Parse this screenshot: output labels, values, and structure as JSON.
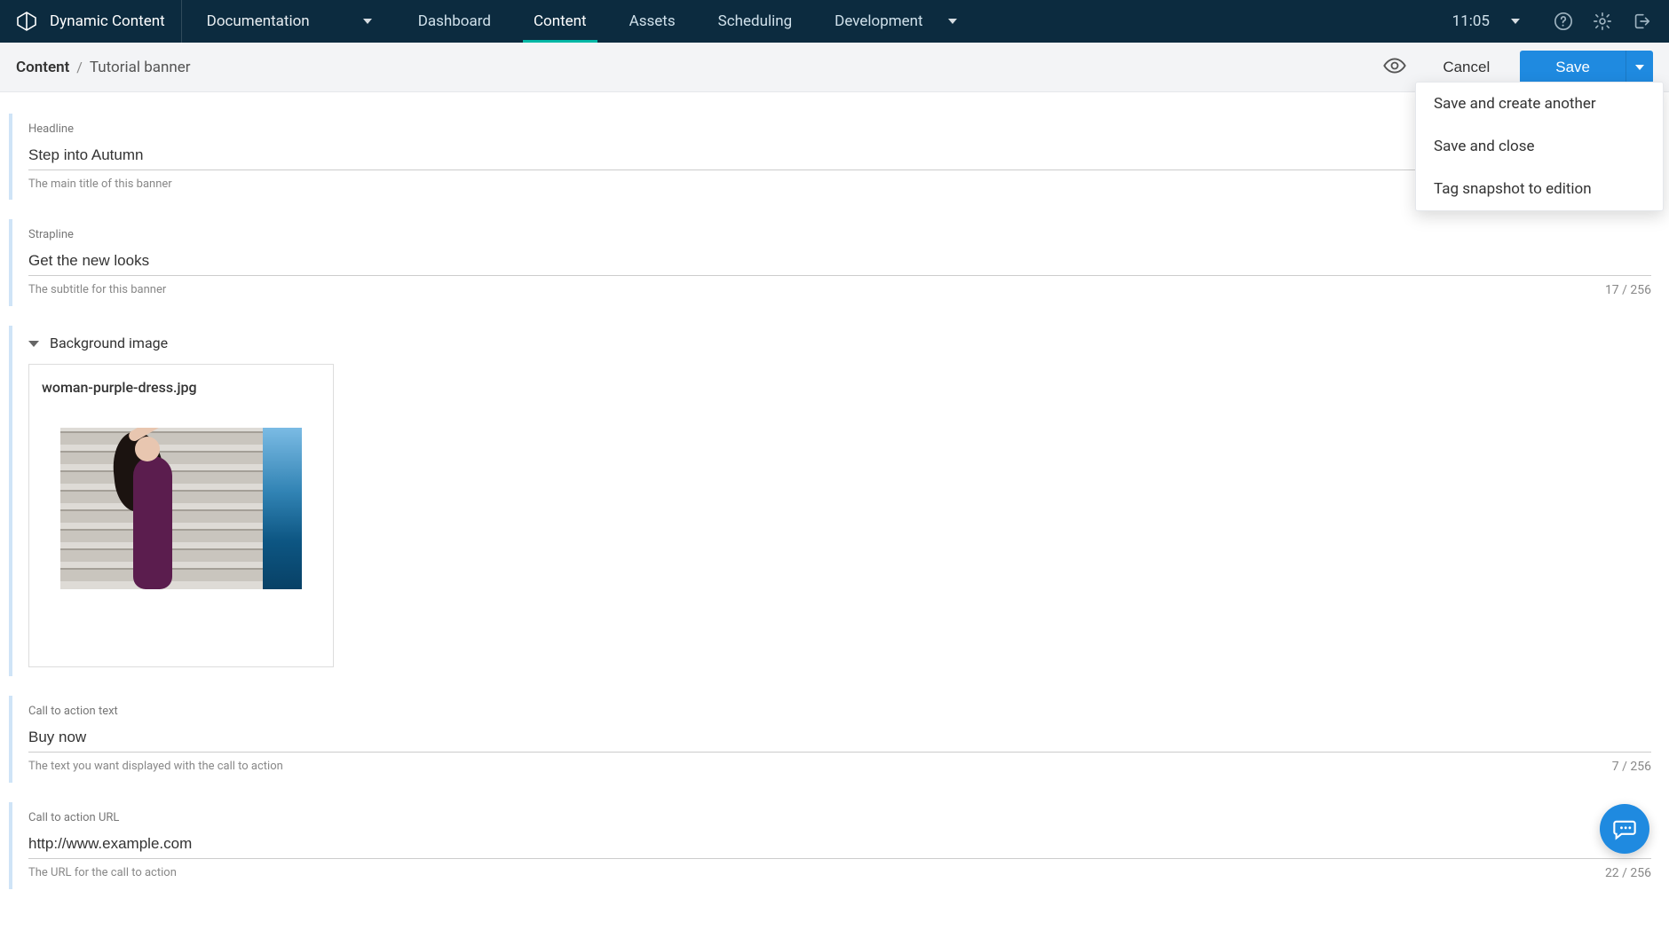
{
  "topbar": {
    "brand": "Dynamic Content",
    "documentation": "Documentation",
    "nav": [
      "Dashboard",
      "Content",
      "Assets",
      "Scheduling"
    ],
    "active_nav_index": 1,
    "development": "Development",
    "clock": "11:05"
  },
  "subbar": {
    "breadcrumb_root": "Content",
    "breadcrumb_leaf": "Tutorial banner",
    "cancel": "Cancel",
    "save": "Save"
  },
  "save_menu": [
    "Save and create another",
    "Save and close",
    "Tag snapshot to edition"
  ],
  "fields": {
    "headline": {
      "label": "Headline",
      "value": "Step into Autumn",
      "help": "The main title of this banner"
    },
    "strapline": {
      "label": "Strapline",
      "value": "Get the new looks",
      "help": "The subtitle for this banner",
      "counter": "17 / 256"
    },
    "background_image": {
      "label": "Background image",
      "filename": "woman-purple-dress.jpg"
    },
    "cta_text": {
      "label": "Call to action text",
      "value": "Buy now",
      "help": "The text you want displayed with the call to action",
      "counter": "7 / 256"
    },
    "cta_url": {
      "label": "Call to action URL",
      "value": "http://www.example.com",
      "help": "The URL for the call to action",
      "counter": "22 / 256"
    }
  }
}
